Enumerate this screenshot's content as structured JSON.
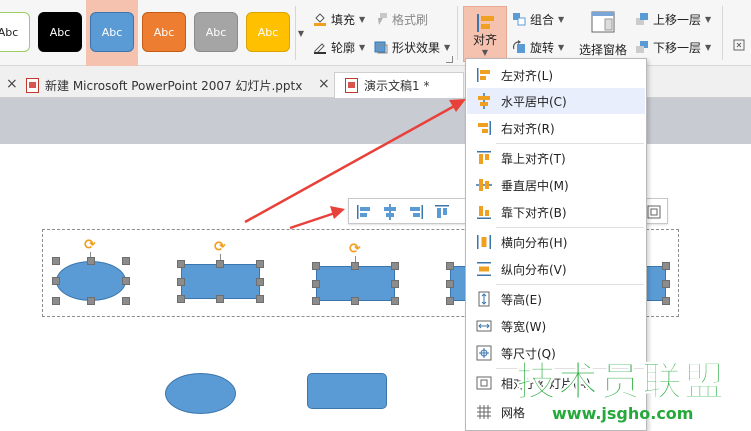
{
  "ribbon": {
    "style_swatches": [
      {
        "label": "Abc",
        "bg": "#ffffff",
        "fg": "#222222",
        "border": "#9ccc65"
      },
      {
        "label": "Abc",
        "bg": "#000000",
        "fg": "#ffffff",
        "border": "#000000"
      },
      {
        "label": "Abc",
        "bg": "#5b9bd5",
        "fg": "#ffffff",
        "border": "#3a76ab"
      },
      {
        "label": "Abc",
        "bg": "#ed7d31",
        "fg": "#ffffff",
        "border": "#c45c14"
      },
      {
        "label": "Abc",
        "bg": "#a5a5a5",
        "fg": "#ffffff",
        "border": "#8a8a8a"
      },
      {
        "label": "Abc",
        "bg": "#ffc000",
        "fg": "#ffffff",
        "border": "#d9a300"
      }
    ],
    "fill_label": "填充",
    "format_brush_label": "格式刷",
    "outline_label": "轮廓",
    "shape_effect_label": "形状效果",
    "align_label": "对齐",
    "group_label": "组合",
    "rotate_label": "旋转",
    "selection_pane_label": "选择窗格",
    "bring_forward_label": "上移一层",
    "send_backward_label": "下移一层"
  },
  "tabs": [
    {
      "label": "新建 Microsoft PowerPoint 2007 幻灯片.pptx",
      "active": false
    },
    {
      "label": "演示文稿1 *",
      "active": true
    }
  ],
  "align_menu": {
    "items": [
      {
        "label": "左对齐(L)",
        "icon": "align-left-icon"
      },
      {
        "label": "水平居中(C)",
        "icon": "align-center-horizontal-icon"
      },
      {
        "label": "右对齐(R)",
        "icon": "align-right-icon"
      },
      {
        "label": "靠上对齐(T)",
        "icon": "align-top-icon"
      },
      {
        "label": "垂直居中(M)",
        "icon": "align-middle-vertical-icon"
      },
      {
        "label": "靠下对齐(B)",
        "icon": "align-bottom-icon"
      },
      {
        "label": "横向分布(H)",
        "icon": "distribute-horizontal-icon"
      },
      {
        "label": "纵向分布(V)",
        "icon": "distribute-vertical-icon"
      },
      {
        "label": "等高(E)",
        "icon": "same-height-icon"
      },
      {
        "label": "等宽(W)",
        "icon": "same-width-icon"
      },
      {
        "label": "等尺寸(Q)",
        "icon": "same-size-icon"
      },
      {
        "label": "相对于幻灯片(A)",
        "icon": "relative-to-slide-icon"
      },
      {
        "label": "网格",
        "icon": "grid-icon"
      }
    ]
  },
  "watermark": {
    "title": "技术员联盟",
    "url": "www.jsgho.com"
  },
  "colors": {
    "accent_arrow": "#e8413a",
    "shape_fill": "#5b9bd5",
    "menu_icon_orange": "#f0a020",
    "watermark_green": "#25a93b"
  }
}
